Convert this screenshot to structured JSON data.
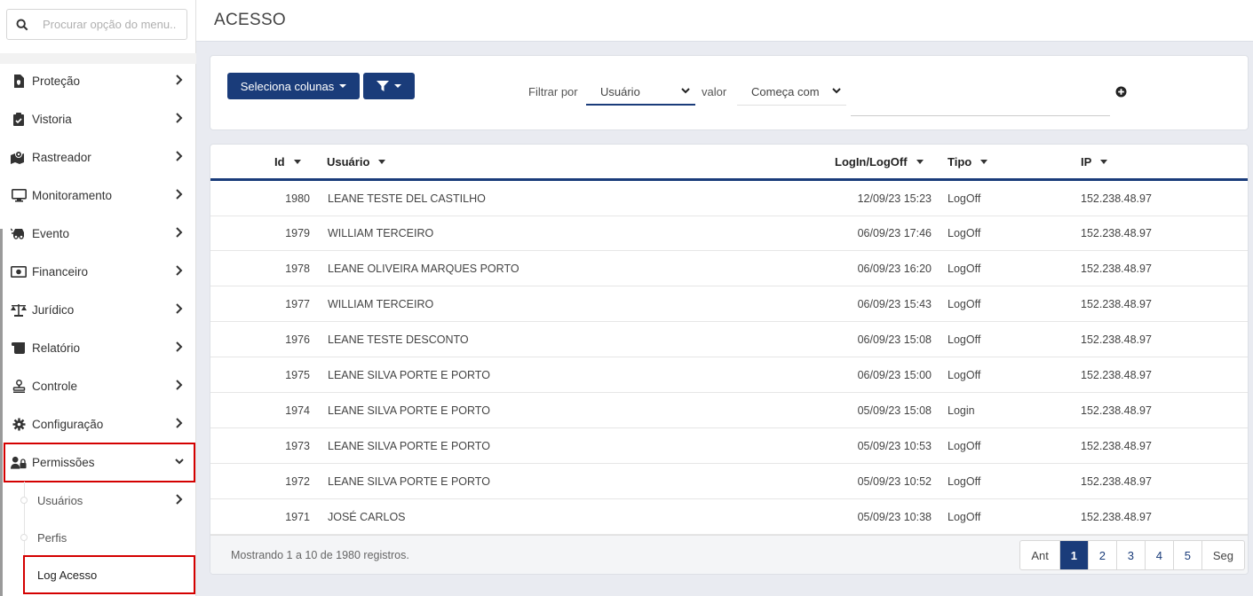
{
  "search": {
    "placeholder": "Procurar opção do menu..."
  },
  "menu": [
    {
      "label": "Proteção",
      "icon": "file-shield-icon"
    },
    {
      "label": "Vistoria",
      "icon": "clipboard-check-icon"
    },
    {
      "label": "Rastreador",
      "icon": "map-marker-icon"
    },
    {
      "label": "Monitoramento",
      "icon": "monitor-icon"
    },
    {
      "label": "Evento",
      "icon": "car-crash-icon"
    },
    {
      "label": "Financeiro",
      "icon": "money-icon"
    },
    {
      "label": "Jurídico",
      "icon": "scale-icon"
    },
    {
      "label": "Relatório",
      "icon": "scroll-icon"
    },
    {
      "label": "Controle",
      "icon": "stamp-icon"
    },
    {
      "label": "Configuração",
      "icon": "gear-icon"
    },
    {
      "label": "Permissões",
      "icon": "user-lock-icon"
    }
  ],
  "submenu": [
    {
      "label": "Usuários"
    },
    {
      "label": "Perfis"
    },
    {
      "label": "Log Acesso"
    }
  ],
  "header": {
    "title": "ACESSO"
  },
  "filters": {
    "columns_button": "Seleciona colunas",
    "filter_by_label": "Filtrar por",
    "field_select": "Usuário",
    "valor_label": "valor",
    "mode_select": "Começa com",
    "value": ""
  },
  "table": {
    "columns": [
      "Id",
      "Usuário",
      "LogIn/LogOff",
      "Tipo",
      "IP"
    ],
    "rows": [
      {
        "id": "1980",
        "user": "LEANE TESTE DEL CASTILHO",
        "date": "12/09/23 15:23",
        "tipo": "LogOff",
        "ip": "152.238.48.97"
      },
      {
        "id": "1979",
        "user": "WILLIAM TERCEIRO",
        "date": "06/09/23 17:46",
        "tipo": "LogOff",
        "ip": "152.238.48.97"
      },
      {
        "id": "1978",
        "user": "LEANE OLIVEIRA MARQUES PORTO",
        "date": "06/09/23 16:20",
        "tipo": "LogOff",
        "ip": "152.238.48.97"
      },
      {
        "id": "1977",
        "user": "WILLIAM TERCEIRO",
        "date": "06/09/23 15:43",
        "tipo": "LogOff",
        "ip": "152.238.48.97"
      },
      {
        "id": "1976",
        "user": "LEANE TESTE DESCONTO",
        "date": "06/09/23 15:08",
        "tipo": "LogOff",
        "ip": "152.238.48.97"
      },
      {
        "id": "1975",
        "user": "LEANE SILVA PORTE E PORTO",
        "date": "06/09/23 15:00",
        "tipo": "LogOff",
        "ip": "152.238.48.97"
      },
      {
        "id": "1974",
        "user": "LEANE SILVA PORTE E PORTO",
        "date": "05/09/23 15:08",
        "tipo": "Login",
        "ip": "152.238.48.97"
      },
      {
        "id": "1973",
        "user": "LEANE SILVA PORTE E PORTO",
        "date": "05/09/23 10:53",
        "tipo": "LogOff",
        "ip": "152.238.48.97"
      },
      {
        "id": "1972",
        "user": "LEANE SILVA PORTE E PORTO",
        "date": "05/09/23 10:52",
        "tipo": "LogOff",
        "ip": "152.238.48.97"
      },
      {
        "id": "1971",
        "user": "JOSÉ CARLOS",
        "date": "05/09/23 10:38",
        "tipo": "LogOff",
        "ip": "152.238.48.97"
      }
    ],
    "summary": "Mostrando 1 a 10 de 1980 registros."
  },
  "pagination": {
    "prev": "Ant",
    "pages": [
      "1",
      "2",
      "3",
      "4",
      "5"
    ],
    "active": "1",
    "next": "Seg"
  },
  "colors": {
    "primary": "#1a3c7a",
    "highlight": "#d40000"
  }
}
